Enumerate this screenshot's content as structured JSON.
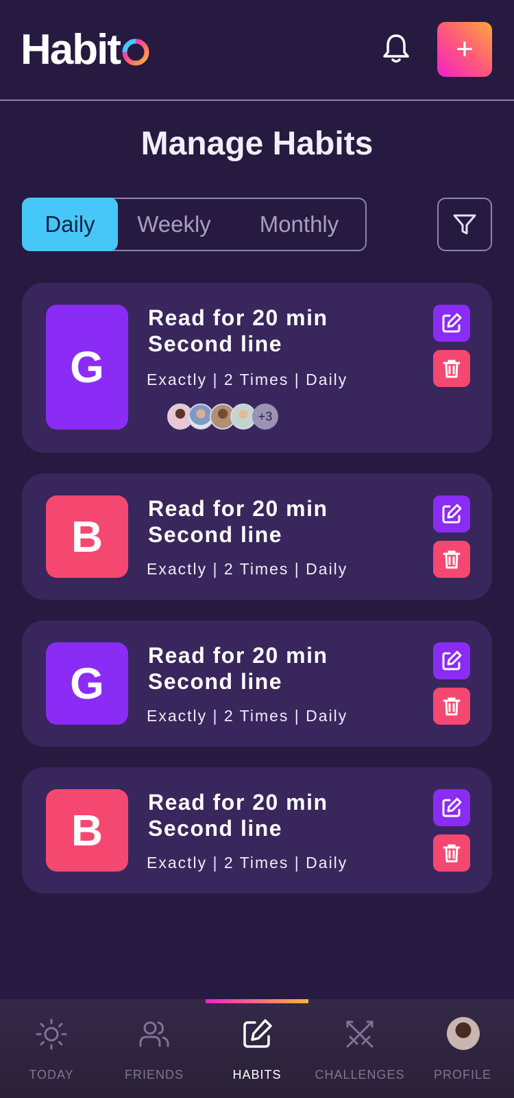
{
  "app": {
    "logo_text": "Habit"
  },
  "header": {
    "add_label": "+"
  },
  "page": {
    "title": "Manage Habits"
  },
  "tabs": [
    {
      "label": "Daily",
      "active": true
    },
    {
      "label": "Weekly",
      "active": false
    },
    {
      "label": "Monthly",
      "active": false
    }
  ],
  "habits": [
    {
      "letter": "G",
      "color": "#8a2cf5",
      "title_line1": "Read for 20 min",
      "title_line2": "Second line",
      "meta": "Exactly | 2 Times | Daily",
      "friends_more": "+3"
    },
    {
      "letter": "B",
      "color": "#f54870",
      "title_line1": "Read for 20 min",
      "title_line2": "Second line",
      "meta": "Exactly | 2 Times | Daily"
    },
    {
      "letter": "G",
      "color": "#8a2cf5",
      "title_line1": "Read for 20 min",
      "title_line2": "Second line",
      "meta": "Exactly | 2 Times | Daily"
    },
    {
      "letter": "B",
      "color": "#f54870",
      "title_line1": "Read for 20 min",
      "title_line2": "Second line",
      "meta": "Exactly | 2 Times | Daily"
    }
  ],
  "nav": {
    "items": [
      {
        "label": "TODAY",
        "icon": "sun-icon"
      },
      {
        "label": "FRIENDS",
        "icon": "users-icon"
      },
      {
        "label": "HABITS",
        "icon": "edit-icon",
        "active": true
      },
      {
        "label": "CHALLENGES",
        "icon": "swords-icon"
      },
      {
        "label": "PROFILE",
        "icon": "avatar"
      }
    ]
  },
  "colors": {
    "background": "#261a40",
    "card": "#38265c",
    "accent_blue": "#46c7f7",
    "purple": "#8a2cf5",
    "pink": "#f54870"
  }
}
